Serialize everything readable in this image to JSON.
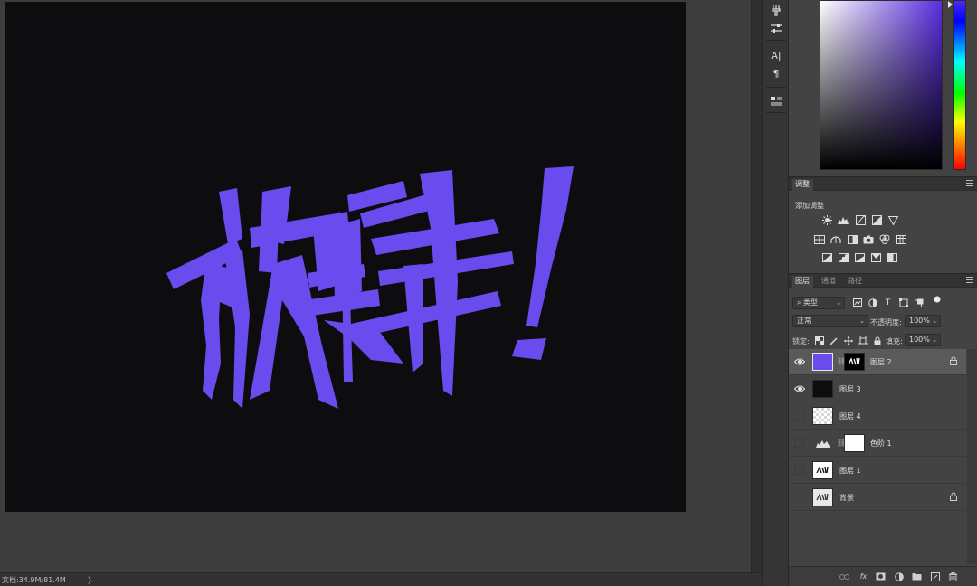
{
  "status": {
    "doc_size": "文档:34.9M/81.4M",
    "arrow": "〉"
  },
  "canvas": {
    "artwork_text": "放肆!",
    "artwork_color": "#6a4bee",
    "background_color": "#0d0d0f"
  },
  "tools": [
    "brush-select-icon",
    "sliders-icon",
    "character-icon",
    "paragraph-icon",
    "properties-icon"
  ],
  "tool_labels": {
    "character": "A|",
    "paragraph": "¶"
  },
  "color_panel": {
    "field_hue": "#5b2ee0"
  },
  "adjustments_panel": {
    "tab": "调整",
    "add_label": "添加调整"
  },
  "layers_panel": {
    "tabs": [
      "图层",
      "通道",
      "路径"
    ],
    "filter_kind": "类型",
    "blend_mode": "正常",
    "opacity_label": "不透明度:",
    "opacity_value": "100%",
    "lock_label": "锁定:",
    "fill_label": "填充:",
    "fill_value": "100%",
    "layers": [
      {
        "name": "图层 2",
        "visible": true,
        "selected": true,
        "locked": true
      },
      {
        "name": "图层 3",
        "visible": true,
        "selected": false,
        "locked": false
      },
      {
        "name": "图层 4",
        "visible": false,
        "selected": false,
        "locked": false
      },
      {
        "name": "色阶 1",
        "visible": false,
        "selected": false,
        "locked": false
      },
      {
        "name": "图层 1",
        "visible": false,
        "selected": false,
        "locked": false
      },
      {
        "name": "背景",
        "visible": false,
        "selected": false,
        "locked": true
      }
    ],
    "bottom_icons": [
      "link-layers-icon",
      "fx-icon",
      "mask-icon",
      "adjustment-layer-icon",
      "group-icon",
      "new-layer-icon",
      "trash-icon"
    ],
    "fx_label": "fx"
  }
}
